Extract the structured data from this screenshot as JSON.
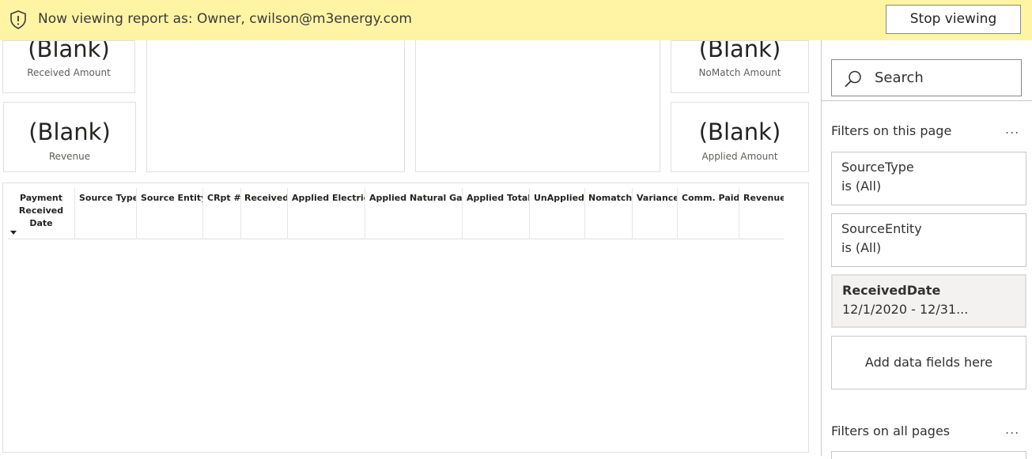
{
  "banner": {
    "message": "Now viewing report as: Owner, cwilson@m3energy.com",
    "stop_label": "Stop viewing"
  },
  "cards": {
    "received": {
      "value": "(Blank)",
      "label": "Received Amount"
    },
    "revenue": {
      "value": "(Blank)",
      "label": "Revenue"
    },
    "nomatch": {
      "value": "(Blank)",
      "label": "NoMatch Amount"
    },
    "applied": {
      "value": "(Blank)",
      "label": "Applied Amount"
    }
  },
  "table": {
    "columns": [
      "Payment Received Date",
      "Source Type",
      "Source Entity",
      "CRpt #",
      "Received",
      "Applied Electric",
      "Applied Natural Gas",
      "Applied Total",
      "UnApplied",
      "Nomatch",
      "Variance",
      "Comm. Paid",
      "Revenue"
    ]
  },
  "filters": {
    "search_placeholder": "Search",
    "page_section_title": "Filters on this page",
    "more_label": "...",
    "items": [
      {
        "name": "SourceType",
        "value": "is (All)"
      },
      {
        "name": "SourceEntity",
        "value": "is (All)"
      },
      {
        "name": "ReceivedDate",
        "value": "12/1/2020 - 12/31..."
      }
    ],
    "add_fields_label": "Add data fields here",
    "all_pages_title": "Filters on all pages"
  },
  "colors": {
    "banner_bg": "#fff4a3",
    "active_filter_bg": "#f3f2f1"
  }
}
